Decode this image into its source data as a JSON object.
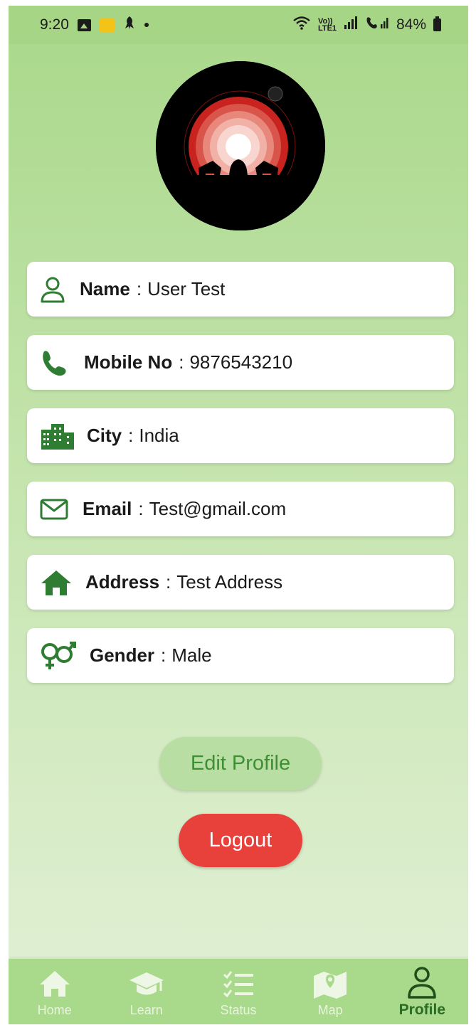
{
  "status_bar": {
    "time": "9:20",
    "network_small": "Vo)) LTE1",
    "battery": "84%"
  },
  "profile": {
    "avatar_icon": "darth-vader-avatar",
    "fields": [
      {
        "icon": "person-outline-icon",
        "label": "Name",
        "sep": ":",
        "value": "User Test"
      },
      {
        "icon": "phone-icon",
        "label": "Mobile No",
        "sep": ":",
        "value": "9876543210"
      },
      {
        "icon": "city-icon",
        "label": "City",
        "sep": ":",
        "value": "India"
      },
      {
        "icon": "email-icon",
        "label": "Email",
        "sep": ":",
        "value": "Test@gmail.com"
      },
      {
        "icon": "home-icon",
        "label": "Address",
        "sep": ":",
        "value": "Test Address"
      },
      {
        "icon": "gender-icon",
        "label": "Gender",
        "sep": ":",
        "value": "Male"
      }
    ]
  },
  "buttons": {
    "edit": "Edit Profile",
    "logout": "Logout"
  },
  "bottom_nav": {
    "items": [
      {
        "label": "Home",
        "icon": "home-icon"
      },
      {
        "label": "Learn",
        "icon": "graduation-cap-icon"
      },
      {
        "label": "Status",
        "icon": "checklist-icon"
      },
      {
        "label": "Map",
        "icon": "map-icon"
      },
      {
        "label": "Profile",
        "icon": "person-outline-icon"
      }
    ],
    "active": "Profile"
  },
  "colors": {
    "background_top": "#a9d88a",
    "card": "#ffffff",
    "icon_green": "#2e7d32",
    "edit_button": "#b9dea3",
    "edit_text": "#3e8f34",
    "logout_button": "#e8413c",
    "nav_bar": "#a9d98a"
  }
}
